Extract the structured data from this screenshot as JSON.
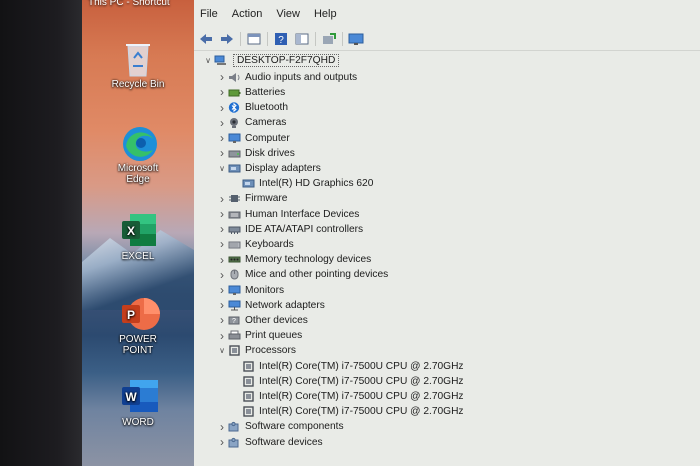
{
  "desktop": {
    "top_cut_label": "This PC - Shortcut",
    "icons": [
      {
        "label": "Recycle Bin",
        "icon": "recycle-bin-icon"
      },
      {
        "label": "Microsoft Edge",
        "icon": "edge-icon"
      },
      {
        "label": "EXCEL",
        "icon": "excel-icon"
      },
      {
        "label": "POWER POINT",
        "icon": "powerpoint-icon"
      },
      {
        "label": "WORD",
        "icon": "word-icon"
      }
    ]
  },
  "menubar": [
    "File",
    "Action",
    "View",
    "Help"
  ],
  "toolbar_icons": [
    "back-arrow-icon",
    "forward-arrow-icon",
    "properties-icon",
    "help-icon",
    "console-icon",
    "update-driver-icon",
    "monitor-icon"
  ],
  "root": {
    "label": "DESKTOP-F2F7QHD",
    "icon": "computer-icon"
  },
  "tree": [
    {
      "label": "Audio inputs and outputs",
      "icon": "speaker-icon",
      "state": "collapsed"
    },
    {
      "label": "Batteries",
      "icon": "battery-icon",
      "state": "collapsed"
    },
    {
      "label": "Bluetooth",
      "icon": "bluetooth-icon",
      "state": "collapsed"
    },
    {
      "label": "Cameras",
      "icon": "camera-icon",
      "state": "collapsed"
    },
    {
      "label": "Computer",
      "icon": "monitor-icon",
      "state": "collapsed"
    },
    {
      "label": "Disk drives",
      "icon": "disk-drive-icon",
      "state": "collapsed"
    },
    {
      "label": "Display adapters",
      "icon": "display-adapter-icon",
      "state": "expanded",
      "children": [
        {
          "label": "Intel(R) HD Graphics 620",
          "icon": "display-adapter-icon"
        }
      ]
    },
    {
      "label": "Firmware",
      "icon": "chip-icon",
      "state": "collapsed"
    },
    {
      "label": "Human Interface Devices",
      "icon": "hid-icon",
      "state": "collapsed"
    },
    {
      "label": "IDE ATA/ATAPI controllers",
      "icon": "controller-icon",
      "state": "collapsed"
    },
    {
      "label": "Keyboards",
      "icon": "keyboard-icon",
      "state": "collapsed"
    },
    {
      "label": "Memory technology devices",
      "icon": "memory-icon",
      "state": "collapsed"
    },
    {
      "label": "Mice and other pointing devices",
      "icon": "mouse-icon",
      "state": "collapsed"
    },
    {
      "label": "Monitors",
      "icon": "monitor-icon",
      "state": "collapsed"
    },
    {
      "label": "Network adapters",
      "icon": "network-icon",
      "state": "collapsed"
    },
    {
      "label": "Other devices",
      "icon": "unknown-device-icon",
      "state": "collapsed"
    },
    {
      "label": "Print queues",
      "icon": "printer-icon",
      "state": "collapsed"
    },
    {
      "label": "Processors",
      "icon": "processor-icon",
      "state": "expanded",
      "children": [
        {
          "label": "Intel(R) Core(TM) i7-7500U CPU @ 2.70GHz",
          "icon": "processor-icon"
        },
        {
          "label": "Intel(R) Core(TM) i7-7500U CPU @ 2.70GHz",
          "icon": "processor-icon"
        },
        {
          "label": "Intel(R) Core(TM) i7-7500U CPU @ 2.70GHz",
          "icon": "processor-icon"
        },
        {
          "label": "Intel(R) Core(TM) i7-7500U CPU @ 2.70GHz",
          "icon": "processor-icon"
        }
      ]
    },
    {
      "label": "Software components",
      "icon": "puzzle-icon",
      "state": "collapsed"
    },
    {
      "label": "Software devices",
      "icon": "puzzle-icon",
      "state": "collapsed"
    }
  ]
}
